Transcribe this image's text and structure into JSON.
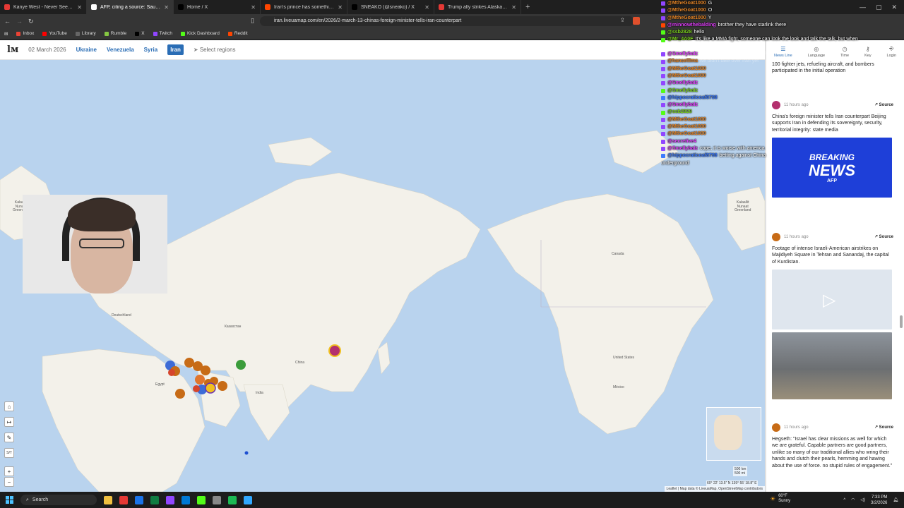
{
  "browser": {
    "tabs": [
      {
        "label": "Kanye West - Never See Me Again -",
        "color": "#e53935",
        "active": false
      },
      {
        "label": "AFP, citing a source: Saudi Arab",
        "color": "#ffffff",
        "active": true
      },
      {
        "label": "Home / X",
        "color": "#000000",
        "active": false
      },
      {
        "label": "Iran's prince has something to say.",
        "color": "#ff4500",
        "active": false
      },
      {
        "label": "SNEAKO (@sneako) / X",
        "color": "#000000",
        "active": false
      },
      {
        "label": "Trump ally strikes Alaska gas deal wit",
        "color": "#e53935",
        "active": false
      }
    ],
    "new_tab": "+",
    "url": "iran.liveuamap.com/en/2026/2-march-13-chinas-foreign-minister-tells-iran-counterpart",
    "bookmarks": [
      {
        "label": "Inbox",
        "color": "#ea4335"
      },
      {
        "label": "YouTube",
        "color": "#ff0000"
      },
      {
        "label": "Library",
        "color": "#666666"
      },
      {
        "label": "Rumble",
        "color": "#85c742"
      },
      {
        "label": "X",
        "color": "#000000"
      },
      {
        "label": "Twitch",
        "color": "#9146ff"
      },
      {
        "label": "Kick Dashboard",
        "color": "#53fc18"
      },
      {
        "label": "Reddit",
        "color": "#ff4500"
      }
    ]
  },
  "site": {
    "logo": "lм",
    "date": "02 March 2026",
    "nav": [
      {
        "label": "Ukraine",
        "active": false
      },
      {
        "label": "Venezuela",
        "active": false
      },
      {
        "label": "Syria",
        "active": false
      },
      {
        "label": "Iran",
        "active": true
      }
    ],
    "select_regions": "Select regions"
  },
  "map": {
    "labels": {
      "greenland_left": "Kalaallit\nNunaat\nGreenland",
      "greenland_right": "Kalaallit\nNunaat\nGreenland",
      "canada": "Canada",
      "united_states": "United States",
      "mexico": "México",
      "china": "China",
      "india": "India",
      "kazakhstan": "Казахстан",
      "deutschland": "Deutschland",
      "egypt": "Egypt"
    },
    "scale_km": "500 km",
    "scale_mi": "500 mi",
    "coords": "60° 22' 13.5\" N 139° 55' 18.8\" E",
    "attribution": "Leaflet | Map data © LiveuaMap, OpenStreetMap contributors",
    "controls": [
      "⌂",
      "↦",
      "✎",
      "S/T",
      "+",
      "−"
    ]
  },
  "sidebar": {
    "tabs": [
      {
        "label": "News Line",
        "icon": "☰",
        "active": true
      },
      {
        "label": "Language",
        "icon": "◎",
        "active": false
      },
      {
        "label": "Time",
        "icon": "◷",
        "active": false
      },
      {
        "label": "Key",
        "icon": "⚷",
        "active": false
      },
      {
        "label": "Login",
        "icon": "⎆",
        "active": false
      }
    ],
    "top_snippet": "100 fighter jets, refueling aircraft, and bombers participated in the initial operation",
    "posts": [
      {
        "time": "11 hours ago",
        "source": "Source",
        "icon_color": "#b3306e",
        "text": "China's foreign minister tells Iran counterpart Beijing supports Iran in defending its sovereignty, security, territorial integrity: state media",
        "image": "breaking"
      },
      {
        "time": "11 hours ago",
        "source": "Source",
        "icon_color": "#c76b16",
        "text": "Footage of intense Israeli-American airstrikes on Majidiyeh Square in Tehran and Sanandaj, the capital of Kurdistan.",
        "image": "video"
      },
      {
        "time": "11 hours ago",
        "source": "Source",
        "icon_color": "#c76b16",
        "text": "Hegseth: \"Israel has clear missions as well for which we are grateful. Capable partners are good partners, unlike so many of our traditional allies who wring their hands and clutch their pearls, hemming and hawing about the use of force. no stupid rules of engagement.\"",
        "image": ""
      }
    ],
    "breaking_line1": "BREAKING",
    "breaking_line2": "NEWS",
    "breaking_tag": "AFP"
  },
  "chat": [
    {
      "user": "@MtheGoat1000",
      "color": "#e8882a",
      "badge": "#9146ff",
      "msg": "G",
      "faded": false
    },
    {
      "user": "@MtheGoat1000",
      "color": "#e8882a",
      "badge": "#9146ff",
      "msg": "O",
      "faded": false
    },
    {
      "user": "@MtheGoat1000",
      "color": "#e8882a",
      "badge": "#9146ff",
      "msg": "Y",
      "faded": false
    },
    {
      "user": "@minnowthebalding",
      "color": "#e040fb",
      "badge": "#ff4500",
      "msg": "brother they have starlink there",
      "faded": false
    },
    {
      "user": "@ssb2828",
      "color": "#7ed321",
      "badge": "#53fc18",
      "msg": "hello",
      "faded": false
    },
    {
      "user": "@Mr_4A0F",
      "color": "#7ed321",
      "badge": "#53fc18",
      "msg": "It's like a MMA fight, someone can look the look and talk the talk, but when",
      "faded": false
    },
    {
      "user": "",
      "color": "#ffffff",
      "badge": "",
      "msg": "words fly it's all over in seconds",
      "faded": true
    },
    {
      "user": "@Smellybalz",
      "color": "#e040fb",
      "badge": "#9146ff",
      "msg": "what do you expect from Iran?",
      "faded": true
    },
    {
      "user": "@hanselllma",
      "color": "#e8882a",
      "badge": "#9146ff",
      "msg": "we didn't take over iran yet",
      "faded": true
    },
    {
      "user": "@MtheGoat1000",
      "color": "#e8882a",
      "badge": "#9146ff",
      "msg": "",
      "faded": true
    },
    {
      "user": "@MtheGoat1000",
      "color": "#e8882a",
      "badge": "#9146ff",
      "msg": "",
      "faded": true
    },
    {
      "user": "@Smellybalz",
      "color": "#e040fb",
      "badge": "#9146ff",
      "msg": "",
      "faded": true
    },
    {
      "user": "@Smellybalz",
      "color": "#7ed321",
      "badge": "#53fc18",
      "msg": "",
      "faded": true
    },
    {
      "user": "@hippocraticoaf8798",
      "color": "#3d7bfd",
      "badge": "#3d7bfd",
      "msg": "",
      "faded": true
    },
    {
      "user": "@Smellybalz",
      "color": "#e040fb",
      "badge": "#9146ff",
      "msg": "",
      "faded": true
    },
    {
      "user": "@ssb2828",
      "color": "#7ed321",
      "badge": "#53fc18",
      "msg": "",
      "faded": true
    },
    {
      "user": "@MtheGoat1000",
      "color": "#e8882a",
      "badge": "#9146ff",
      "msg": "",
      "faded": true
    },
    {
      "user": "@MtheGoat1000",
      "color": "#e8882a",
      "badge": "#9146ff",
      "msg": "",
      "faded": true
    },
    {
      "user": "",
      "color": "#ffffff",
      "badge": "",
      "msg": "",
      "faded": true
    },
    {
      "user": "@MtheGoat1000",
      "color": "#e8882a",
      "badge": "#9146ff",
      "msg": "",
      "faded": true
    },
    {
      "user": "@secretive4",
      "color": "#e040fb",
      "badge": "#9146ff",
      "msg": "",
      "faded": true
    },
    {
      "user": "@Smellybalz",
      "color": "#e040fb",
      "badge": "#9146ff",
      "msg": "cope, it is worse with america",
      "faded": false
    },
    {
      "user": "@hippocraticoaf8798",
      "color": "#3d7bfd",
      "badge": "#3d7bfd",
      "msg": "betting against China",
      "faded": false
    },
    {
      "user": "",
      "color": "#ffffff",
      "badge": "",
      "msg": "underground",
      "faded": false
    }
  ],
  "taskbar": {
    "search": "Search",
    "apps": [
      "#f0c040",
      "#e53935",
      "#1a73e8",
      "#107c41",
      "#9146ff",
      "#0078d4",
      "#53fc18",
      "#888888",
      "#1db954",
      "#31a8ff"
    ],
    "weather_temp": "60°F",
    "weather_desc": "Sunny",
    "time": "7:33 PM",
    "date": "3/2/2026"
  }
}
